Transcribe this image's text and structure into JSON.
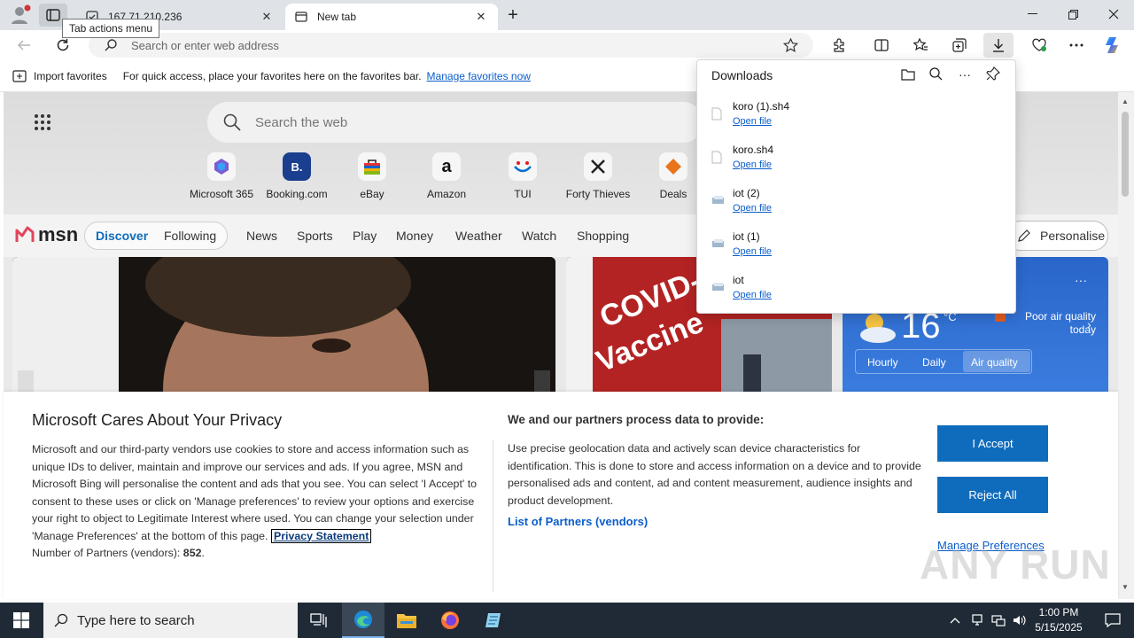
{
  "browser": {
    "tabs": [
      {
        "title": "167.71.210.236"
      },
      {
        "title": "New tab"
      }
    ],
    "tooltip": "Tab actions menu",
    "address_placeholder": "Search or enter web address",
    "favorites_bar": {
      "import_label": "Import favorites",
      "hint": "For quick access, place your favorites here on the favorites bar.",
      "manage_link": "Manage favorites now"
    }
  },
  "downloads": {
    "title": "Downloads",
    "items": [
      {
        "name": "koro (1).sh4",
        "action": "Open file"
      },
      {
        "name": "koro.sh4",
        "action": "Open file"
      },
      {
        "name": "iot (2)",
        "action": "Open file"
      },
      {
        "name": "iot (1)",
        "action": "Open file"
      },
      {
        "name": "iot",
        "action": "Open file"
      }
    ]
  },
  "newtab": {
    "search_placeholder": "Search the web",
    "quick_links": [
      {
        "label": "Microsoft 365"
      },
      {
        "label": "Booking.com",
        "badge": "B."
      },
      {
        "label": "eBay"
      },
      {
        "label": "Amazon",
        "badge": "a"
      },
      {
        "label": "TUI"
      },
      {
        "label": "Forty Thieves"
      },
      {
        "label": "Deals"
      }
    ],
    "msn": {
      "logo": "msn",
      "nav": [
        "Discover",
        "Following",
        "News",
        "Sports",
        "Play",
        "Money",
        "Weather",
        "Watch",
        "Shopping"
      ],
      "personalise": "Personalise"
    },
    "weather": {
      "temp": "16",
      "unit": "°C",
      "air_quality_note": "Poor air quality today",
      "tabs": [
        "Hourly",
        "Daily",
        "Air quality"
      ]
    }
  },
  "privacy": {
    "title": "Microsoft Cares About Your Privacy",
    "body": "Microsoft and our third-party vendors use cookies to store and access information such as unique IDs to deliver, maintain and improve our services and ads. If you agree, MSN and Microsoft Bing will personalise the content and ads that you see. You can select 'I Accept' to consent to these uses or click on 'Manage preferences' to review your options and exercise your right to object to Legitimate Interest where used.  You can change your selection under 'Manage Preferences' at the bottom of this page.",
    "privacy_statement": "Privacy Statement",
    "partners_label": "Number of Partners (vendors):",
    "partners_count": "852",
    "partners_suffix": ".",
    "right_title": "We and our partners process data to provide:",
    "right_body": "Use precise geolocation data and actively scan device characteristics for identification. This is done to store and access information on a device and to provide personalised ads and content, ad and content measurement, audience insights and product development.",
    "vendors_link": "List of Partners (vendors)",
    "accept": "I Accept",
    "reject": "Reject All",
    "manage": "Manage Preferences"
  },
  "watermark": "ANY RUN",
  "taskbar": {
    "search_placeholder": "Type here to search",
    "time": "1:00 PM",
    "date": "5/15/2025"
  },
  "colors": {
    "accent": "#0f6cbd",
    "link": "#0a5ecb",
    "taskbar": "#1f2a36"
  }
}
